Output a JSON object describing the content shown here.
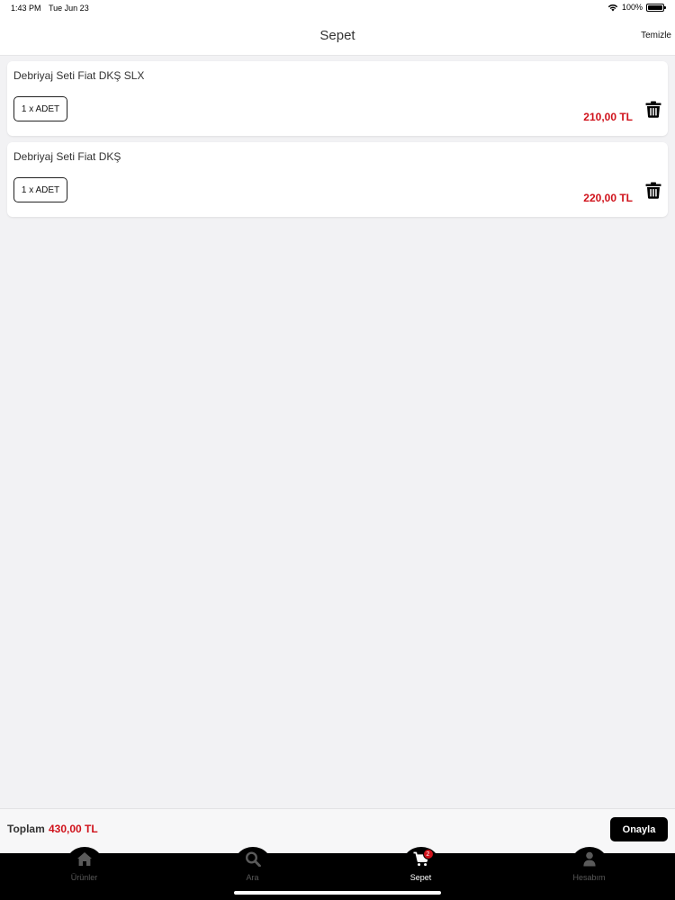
{
  "status_bar": {
    "time": "1:43 PM",
    "date": "Tue Jun 23",
    "battery": "100%"
  },
  "nav": {
    "title": "Sepet",
    "clear_label": "Temizle"
  },
  "cart_items": [
    {
      "name": "Debriyaj Seti Fiat DKŞ SLX",
      "quantity": "1 x ADET",
      "price": "210,00 TL",
      "icon": "trash-icon"
    },
    {
      "name": "Debriyaj Seti Fiat DKŞ",
      "quantity": "1 x ADET",
      "price": "220,00 TL",
      "icon": "trash-icon"
    }
  ],
  "total": {
    "label": "Toplam",
    "value": "430,00 TL",
    "confirm_label": "Onayla"
  },
  "tabs": [
    {
      "label": "Ürünler",
      "icon": "home-icon",
      "active": false
    },
    {
      "label": "Ara",
      "icon": "search-icon",
      "active": false
    },
    {
      "label": "Sepet",
      "icon": "cart-icon",
      "active": true,
      "badge": "2"
    },
    {
      "label": "Hesabım",
      "icon": "user-icon",
      "active": false
    }
  ],
  "colors": {
    "accent": "#d0121b",
    "tab_bar": "#000000",
    "background": "#f2f2f4"
  }
}
